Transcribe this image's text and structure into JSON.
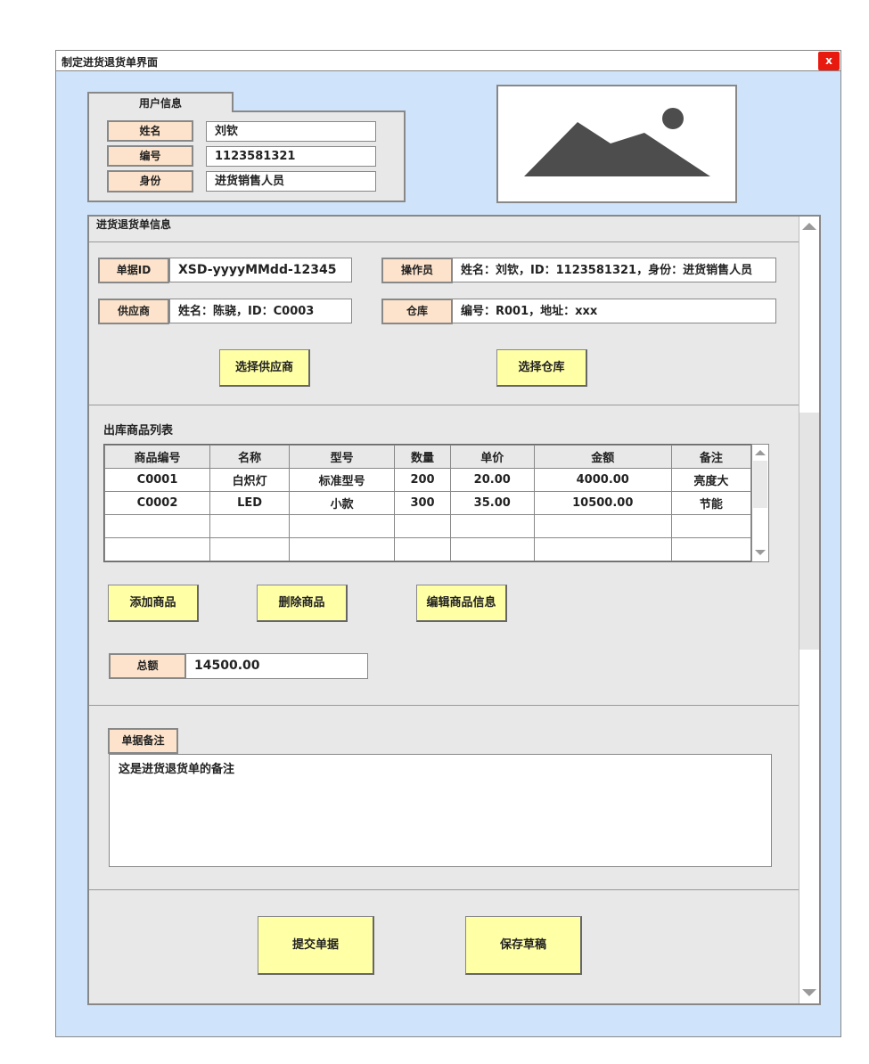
{
  "window": {
    "title": "制定进货退货单界面",
    "close_label": "x"
  },
  "user_info": {
    "tab_label": "用户信息",
    "fields": [
      {
        "label": "姓名",
        "value": "刘钦"
      },
      {
        "label": "编号",
        "value": "1123581321"
      },
      {
        "label": "身份",
        "value": "进货销售人员"
      }
    ]
  },
  "image_placeholder": {
    "icon": "image-icon"
  },
  "form": {
    "section_title": "进货退货单信息",
    "receipt_id": {
      "label": "单据ID",
      "value": "XSD-yyyyMMdd-12345"
    },
    "operator": {
      "label": "操作员",
      "value": "姓名：刘钦，ID：1123581321，身份：进货销售人员"
    },
    "supplier": {
      "label": "供应商",
      "value": "姓名：陈骁，ID：C0003"
    },
    "warehouse": {
      "label": "仓库",
      "value": "编号：R001，地址：xxx"
    },
    "select_supplier_label": "选择供应商",
    "select_warehouse_label": "选择仓库"
  },
  "goods": {
    "title": "出库商品列表",
    "columns": [
      "商品编号",
      "名称",
      "型号",
      "数量",
      "单价",
      "金额",
      "备注"
    ],
    "rows": [
      [
        "C0001",
        "白炽灯",
        "标准型号",
        "200",
        "20.00",
        "4000.00",
        "亮度大"
      ],
      [
        "C0002",
        "LED",
        "小款",
        "300",
        "35.00",
        "10500.00",
        "节能"
      ],
      [
        "",
        "",
        "",
        "",
        "",
        "",
        ""
      ],
      [
        "",
        "",
        "",
        "",
        "",
        "",
        ""
      ]
    ],
    "add_label": "添加商品",
    "delete_label": "删除商品",
    "edit_label": "编辑商品信息",
    "total_label": "总额",
    "total_value": "14500.00"
  },
  "memo": {
    "label": "单据备注",
    "value": "这是进货退货单的备注"
  },
  "actions": {
    "submit_label": "提交单据",
    "save_draft_label": "保存草稿"
  },
  "colors": {
    "window_bg": "#cfe4fb",
    "label_bg": "#fde3cb",
    "button_bg": "#ffffa6",
    "close_bg": "#e8190e"
  }
}
